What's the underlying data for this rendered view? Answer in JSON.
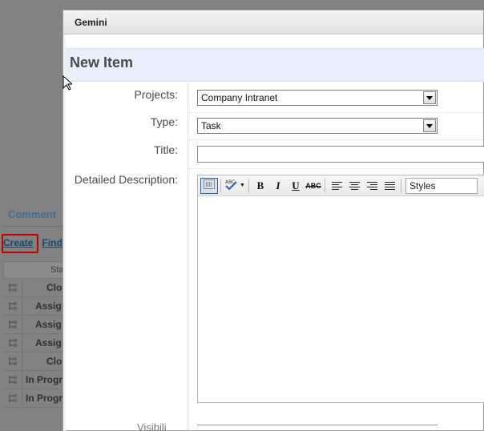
{
  "background": {
    "section_title": "Comment",
    "links": {
      "create": "Create",
      "separator": "|",
      "find": "Find"
    },
    "table_header": "Sta",
    "rows": [
      {
        "status": "Clo"
      },
      {
        "status": "Assig"
      },
      {
        "status": "Assig"
      },
      {
        "status": "Assig"
      },
      {
        "status": "Clo"
      },
      {
        "status": "In Progr"
      },
      {
        "status": "In Progr"
      }
    ]
  },
  "modal": {
    "window_title": "Gemini",
    "heading": "New Item",
    "fields": {
      "projects": {
        "label": "Projects:",
        "value": "Company Intranet"
      },
      "type": {
        "label": "Type:",
        "value": "Task"
      },
      "title": {
        "label": "Title:",
        "value": ""
      },
      "description": {
        "label": "Detailed Description:"
      }
    },
    "editor": {
      "styles_label": "Styles",
      "buttons": {
        "bold": "B",
        "italic": "I",
        "underline": "U",
        "strike": "ABC"
      }
    },
    "bottom_label": "Visibili"
  },
  "icons": {
    "source-view": "dotted-box-icon",
    "spellcheck": "abc-check-icon",
    "tree": "tree-icon",
    "cursor": "mouse-pointer-icon"
  }
}
